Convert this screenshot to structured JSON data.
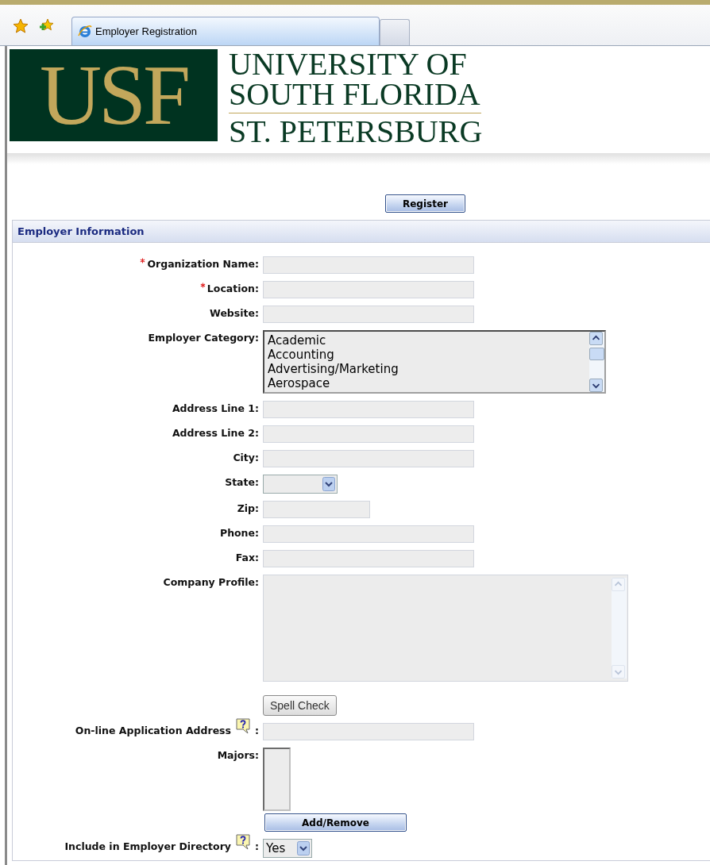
{
  "browser": {
    "tab_title": "Employer Registration"
  },
  "logo": {
    "mark": "USF",
    "lines": [
      "UNIVERSITY OF",
      "SOUTH FLORIDA",
      "ST. PETERSBURG"
    ]
  },
  "register_button": "Register",
  "section": {
    "title": "Employer Information"
  },
  "fields": [
    {
      "label": "Organization Name:",
      "required": true,
      "help": false,
      "kind": "text"
    },
    {
      "label": "Location:",
      "required": true,
      "help": false,
      "kind": "text"
    },
    {
      "label": "Website:",
      "required": false,
      "help": false,
      "kind": "text"
    },
    {
      "label": "Employer Category:",
      "required": false,
      "help": false,
      "kind": "listbox",
      "options": [
        "Academic",
        "Accounting",
        "Advertising/Marketing",
        "Aerospace"
      ]
    },
    {
      "label": "Address Line 1:",
      "required": false,
      "help": false,
      "kind": "text"
    },
    {
      "label": "Address Line 2:",
      "required": false,
      "help": false,
      "kind": "text"
    },
    {
      "label": "City:",
      "required": false,
      "help": false,
      "kind": "text"
    },
    {
      "label": "State:",
      "required": false,
      "help": false,
      "kind": "select"
    },
    {
      "label": "Zip:",
      "required": false,
      "help": false,
      "kind": "short"
    },
    {
      "label": "Phone:",
      "required": false,
      "help": false,
      "kind": "text"
    },
    {
      "label": "Fax:",
      "required": false,
      "help": false,
      "kind": "text"
    },
    {
      "label": "Company Profile:",
      "required": false,
      "help": false,
      "kind": "textarea",
      "button": "Spell Check"
    },
    {
      "label": "On-line Application Address",
      "colon": ":",
      "required": false,
      "help": true,
      "kind": "text"
    },
    {
      "label": "Majors:",
      "required": false,
      "help": false,
      "kind": "multi",
      "button": "Add/Remove"
    },
    {
      "label": "Include in Employer Directory",
      "colon": ":",
      "required": false,
      "help": true,
      "kind": "select",
      "value": "Yes"
    }
  ]
}
